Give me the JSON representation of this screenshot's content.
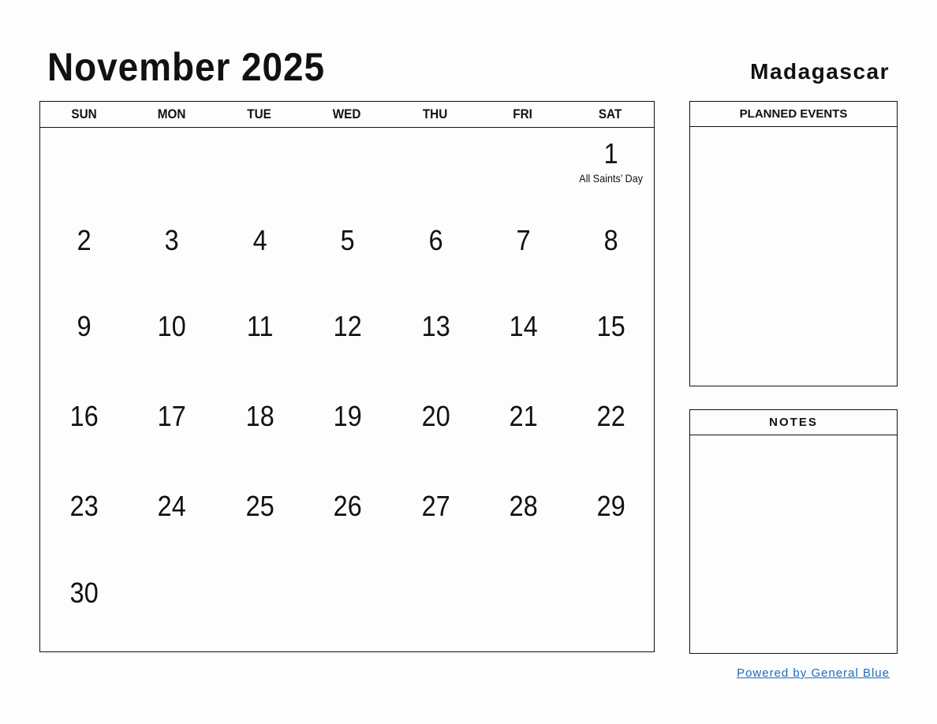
{
  "header": {
    "title": "November 2025",
    "country": "Madagascar"
  },
  "calendar": {
    "weekdays": [
      "SUN",
      "MON",
      "TUE",
      "WED",
      "THU",
      "FRI",
      "SAT"
    ],
    "first_weekday_index": 6,
    "days_in_month": 30,
    "holidays": {
      "1": "All Saints’ Day"
    }
  },
  "panels": {
    "planned_events": "PLANNED EVENTS",
    "notes": "NOTES"
  },
  "footer": {
    "powered_by": "Powered by General Blue",
    "link_color": "#1a6bbf"
  }
}
